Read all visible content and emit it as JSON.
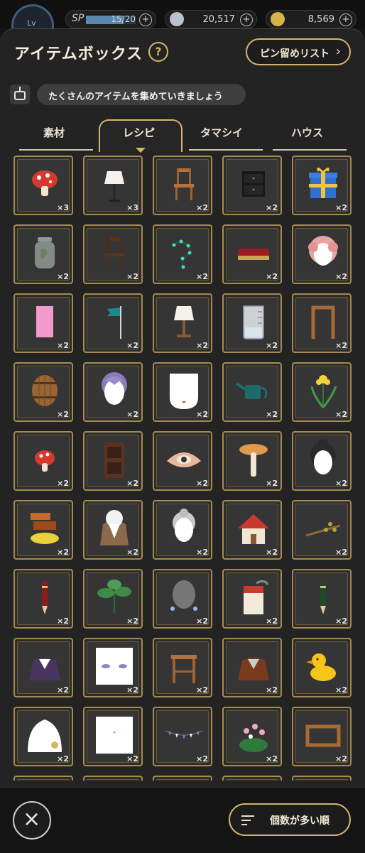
{
  "status_bar": {
    "level_label": "Lv",
    "sp_label": "SP",
    "sp_value": "15/20",
    "sp_fraction": 0.75,
    "currency_1": "20,517",
    "currency_2": "8,569",
    "plus_label": "+"
  },
  "header": {
    "title": "アイテムボックス",
    "help_label": "?",
    "pin_list_label": "ピン留めリスト",
    "pin_list_arrow": "›"
  },
  "assistant": {
    "message": "たくさんのアイテムを集めていきましょう"
  },
  "tabs": [
    {
      "label": "素材",
      "active": false
    },
    {
      "label": "レシピ",
      "active": true
    },
    {
      "label": "タマシイ",
      "active": false
    },
    {
      "label": "ハウス",
      "active": false
    }
  ],
  "items": [
    {
      "icon": "mushroom-icon",
      "count": "×3"
    },
    {
      "icon": "floor-lamp-icon",
      "count": "×3"
    },
    {
      "icon": "wooden-chair-icon",
      "count": "×2"
    },
    {
      "icon": "nightstand-icon",
      "count": "×2"
    },
    {
      "icon": "gift-box-icon",
      "count": "×2"
    },
    {
      "icon": "jar-icon",
      "count": "×2"
    },
    {
      "icon": "dark-chair-icon",
      "count": "×2"
    },
    {
      "icon": "string-lights-icon",
      "count": "×2"
    },
    {
      "icon": "red-cushion-icon",
      "count": "×2"
    },
    {
      "icon": "pink-hair-icon",
      "count": "×2"
    },
    {
      "icon": "pink-panel-icon",
      "count": "×2"
    },
    {
      "icon": "flag-icon",
      "count": "×2"
    },
    {
      "icon": "table-lamp-icon",
      "count": "×2"
    },
    {
      "icon": "beaker-icon",
      "count": "×2"
    },
    {
      "icon": "door-frame-icon",
      "count": "×2"
    },
    {
      "icon": "barrel-icon",
      "count": "×2"
    },
    {
      "icon": "purple-hair-icon",
      "count": "×2"
    },
    {
      "icon": "face-icon",
      "count": "×2"
    },
    {
      "icon": "watering-can-icon",
      "count": "×2"
    },
    {
      "icon": "iris-flower-icon",
      "count": "×2"
    },
    {
      "icon": "small-mushroom-icon",
      "count": "×2"
    },
    {
      "icon": "shelf-icon",
      "count": "×2"
    },
    {
      "icon": "eye-ornament-icon",
      "count": "×2"
    },
    {
      "icon": "tall-mushroom-icon",
      "count": "×2"
    },
    {
      "icon": "black-hair-icon",
      "count": "×2"
    },
    {
      "icon": "stacked-pots-icon",
      "count": "×2"
    },
    {
      "icon": "white-collar-outfit-icon",
      "count": "×2"
    },
    {
      "icon": "gray-hair-icon",
      "count": "×2"
    },
    {
      "icon": "house-icon",
      "count": "×2"
    },
    {
      "icon": "branch-icon",
      "count": "×2"
    },
    {
      "icon": "red-pencil-icon",
      "count": "×2"
    },
    {
      "icon": "potted-plant-icon",
      "count": "×2"
    },
    {
      "icon": "earrings-icon",
      "count": "×2"
    },
    {
      "icon": "soup-can-icon",
      "count": "×2"
    },
    {
      "icon": "green-pencil-icon",
      "count": "×2"
    },
    {
      "icon": "purple-blouse-icon",
      "count": "×2"
    },
    {
      "icon": "face-eyes-icon",
      "count": "×2"
    },
    {
      "icon": "stool-icon",
      "count": "×2"
    },
    {
      "icon": "brown-blouse-icon",
      "count": "×2"
    },
    {
      "icon": "rubber-duck-icon",
      "count": "×2"
    },
    {
      "icon": "brooch-icon",
      "count": "×2"
    },
    {
      "icon": "face-pale-icon",
      "count": "×2"
    },
    {
      "icon": "bunting-icon",
      "count": "×2"
    },
    {
      "icon": "flower-bush-icon",
      "count": "×2"
    },
    {
      "icon": "wooden-frame-icon",
      "count": "×2"
    }
  ],
  "footer": {
    "close_label": "×",
    "sort_label": "個数が多い順"
  },
  "colors": {
    "accent_gold": "#d6b56a",
    "panel": "#232323",
    "slot_border": "#a68a4f"
  }
}
